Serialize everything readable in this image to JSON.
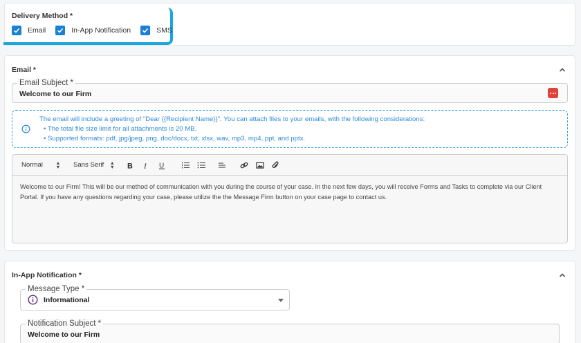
{
  "delivery": {
    "title": "Delivery Method *",
    "options": [
      {
        "label": "Email",
        "checked": true
      },
      {
        "label": "In-App Notification",
        "checked": true
      },
      {
        "label": "SMS",
        "checked": true
      }
    ]
  },
  "email": {
    "section_title": "Email *",
    "subject_legend": "Email Subject *",
    "subject_value": "Welcome to our Firm",
    "info_lines": [
      "The email will include a greeting of \"Dear {{Recipient Name}}\". You can attach files to your emails, with the following considerations:",
      "• The total file size limit for all attachments is 20 MB.",
      "• Supported formats: pdf, jpg/jpeg, png, doc/docx, txt, xlsx, wav, mp3, mp4, ppt, and pptx."
    ],
    "toolbar": {
      "size_value": "Normal",
      "font_value": "Sans Serif"
    },
    "body_text": "Welcome to our Firm! This will be our method of communication with you during the course of your case. In the next few days, you will receive Forms and Tasks to complete via our Client Portal. If you have any questions regarding your case, please utilize the the Message Firm button on your case page to contact us."
  },
  "notification": {
    "section_title": "In-App Notification *",
    "message_type_legend": "Message Type *",
    "message_type_value": "Informational",
    "subject_legend": "Notification Subject *",
    "subject_value": "Welcome to our Firm"
  },
  "colors": {
    "accent": "#1a7fd6",
    "highlight": "#1aa6dc",
    "info": "#2d8ad6",
    "danger": "#e0433a",
    "info_type": "#5b2a86"
  },
  "icons": [
    "check-icon",
    "chevron-up-icon",
    "info-icon",
    "more-dots-icon",
    "bold-icon",
    "italic-icon",
    "underline-icon",
    "ordered-list-icon",
    "bullet-list-icon",
    "align-icon",
    "link-icon",
    "image-icon",
    "attachment-icon",
    "caret-down-icon"
  ]
}
